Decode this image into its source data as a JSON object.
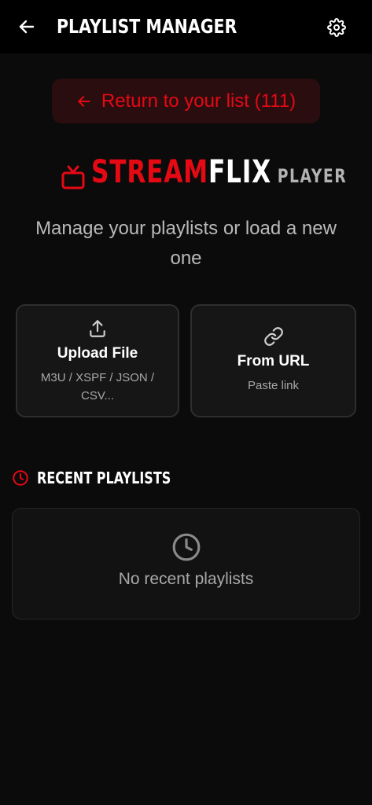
{
  "header": {
    "title": "PLAYLIST MANAGER",
    "back_icon": "arrow-left-icon",
    "settings_icon": "gear-icon"
  },
  "return_button": {
    "label": "Return to your list (111)",
    "icon": "arrow-left-icon"
  },
  "logo": {
    "part1": "STREAM",
    "part2": "FLIX",
    "part3": "PLAYER",
    "icon": "tv-icon"
  },
  "tagline": "Manage your playlists or load a new one",
  "options": {
    "upload": {
      "title": "Upload File",
      "subtitle": "M3U / XSPF / JSON / CSV...",
      "icon": "upload-icon"
    },
    "url": {
      "title": "From URL",
      "subtitle": "Paste link",
      "icon": "link-icon"
    }
  },
  "recent": {
    "title": "RECENT PLAYLISTS",
    "icon": "clock-icon",
    "empty_label": "No recent playlists",
    "empty_icon": "clock-icon"
  },
  "colors": {
    "accent": "#e50914",
    "background": "#0b0b0b",
    "card": "#161616"
  }
}
